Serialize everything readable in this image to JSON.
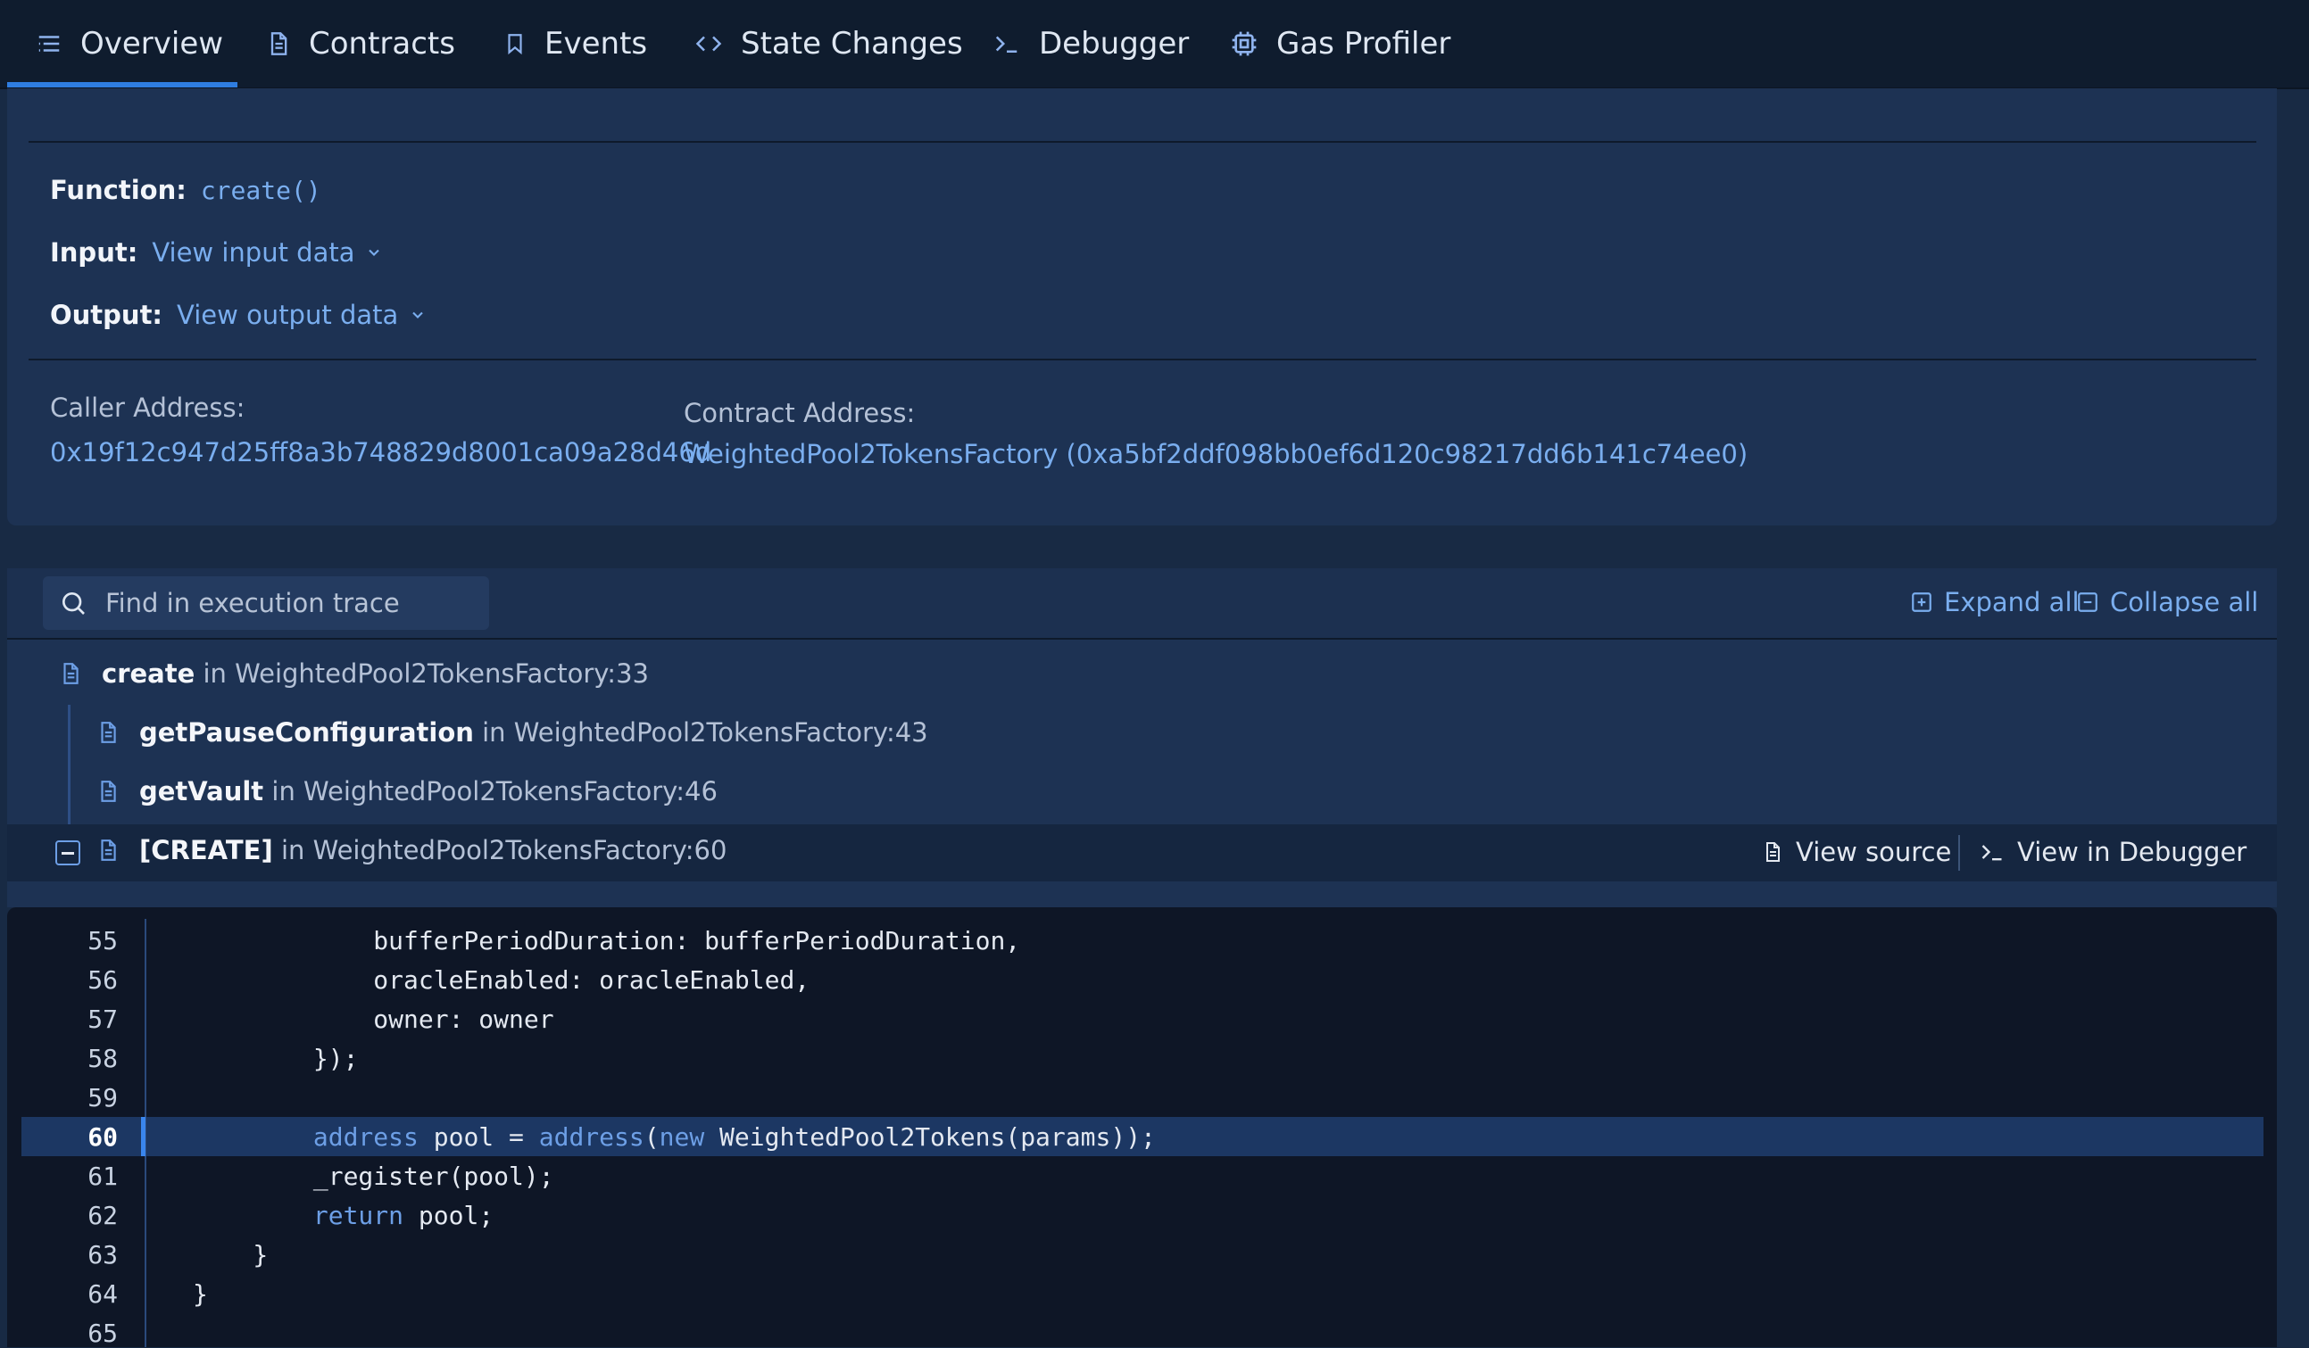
{
  "tabs": [
    {
      "label": "Overview",
      "icon": "list-icon",
      "active": true
    },
    {
      "label": "Contracts",
      "icon": "file-icon"
    },
    {
      "label": "Events",
      "icon": "bookmark-icon"
    },
    {
      "label": "State Changes",
      "icon": "code-icon"
    },
    {
      "label": "Debugger",
      "icon": "terminal-icon"
    },
    {
      "label": "Gas Profiler",
      "icon": "chip-icon"
    }
  ],
  "overview": {
    "function_label": "Function:",
    "function_value": "create()",
    "input_label": "Input:",
    "input_link": "View input data",
    "output_label": "Output:",
    "output_link": "View output data",
    "caller_label": "Caller Address:",
    "caller_value": "0x19f12c947d25ff8a3b748829d8001ca09a28d46d",
    "contract_label": "Contract Address:",
    "contract_value": "WeightedPool2TokensFactory (0xa5bf2ddf098bb0ef6d120c98217dd6b141c74ee0)"
  },
  "trace": {
    "search_placeholder": "Find in execution trace",
    "expand_all": "Expand all",
    "collapse_all": "Collapse all",
    "rows": [
      {
        "fn": "create",
        "loc": "in WeightedPool2TokensFactory:33"
      },
      {
        "fn": "getPauseConfiguration",
        "loc": "in WeightedPool2TokensFactory:43"
      },
      {
        "fn": "getVault",
        "loc": "in WeightedPool2TokensFactory:46"
      },
      {
        "fn": "[CREATE]",
        "loc": "in WeightedPool2TokensFactory:60"
      }
    ],
    "view_source": "View source",
    "view_debugger": "View in Debugger"
  },
  "code": {
    "lines": [
      {
        "n": "55",
        "text": "            bufferPeriodDuration: bufferPeriodDuration,"
      },
      {
        "n": "56",
        "text": "            oracleEnabled: oracleEnabled,"
      },
      {
        "n": "57",
        "text": "            owner: owner"
      },
      {
        "n": "58",
        "text": "        });"
      },
      {
        "n": "59",
        "text": ""
      },
      {
        "n": "60",
        "text": "        address pool = address(new WeightedPool2Tokens(params));"
      },
      {
        "n": "61",
        "text": "        _register(pool);"
      },
      {
        "n": "62",
        "text": "        return pool;"
      },
      {
        "n": "63",
        "text": "    }"
      },
      {
        "n": "64",
        "text": "}"
      },
      {
        "n": "65",
        "text": ""
      }
    ],
    "highlight_line": "60"
  },
  "colors": {
    "accent": "#2f7de1",
    "link": "#7aaeef",
    "keyword": "#6d9fe6"
  }
}
